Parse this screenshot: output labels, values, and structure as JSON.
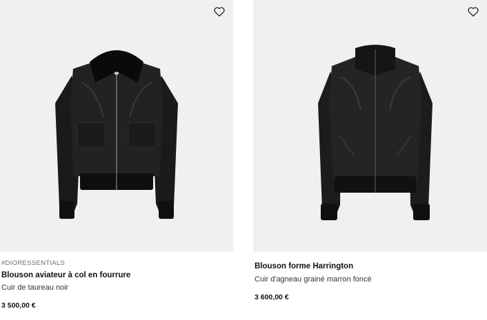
{
  "products": [
    {
      "tag": "#DIORESSENTIALS",
      "name": "Blouson aviateur à col en fourrure",
      "description": "Cuir de taureau noir",
      "price": "3 500,00 €",
      "image_icon": "aviator-jacket-image",
      "wishlist_icon": "heart-icon"
    },
    {
      "name": "Blouson forme Harrington",
      "description": "Cuir d'agneau grainé marron foncé",
      "price": "3 600,00 €",
      "image_icon": "harrington-jacket-image",
      "wishlist_icon": "heart-icon"
    }
  ],
  "colors": {
    "image_background": "#f0f0f0",
    "jacket": "#1c1c1c",
    "text": "#111111",
    "tag": "#6d6d6d"
  }
}
